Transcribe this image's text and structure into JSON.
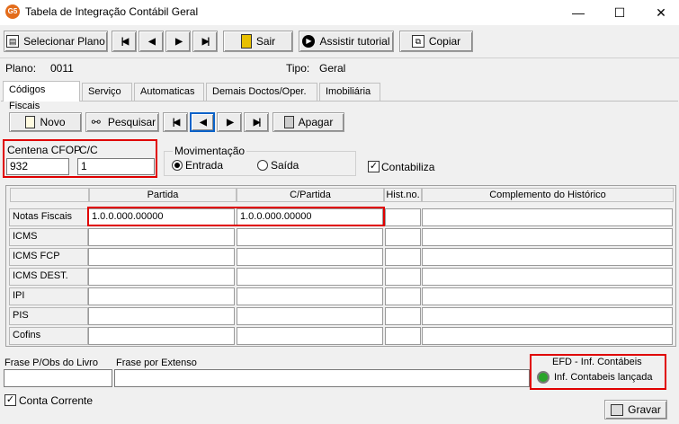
{
  "window": {
    "title": "Tabela de Integração Contábil Geral",
    "app_icon": "G5",
    "minimize": "—",
    "maximize": "☐",
    "close": "✕"
  },
  "toolbar": {
    "select_plan": "Selecionar Plano",
    "exit": "Sair",
    "tutorial": "Assistir tutorial",
    "copy": "Copiar"
  },
  "plan": {
    "plano_label": "Plano:",
    "plano_value": "0011",
    "tipo_label": "Tipo:",
    "tipo_value": "Geral"
  },
  "tabs": [
    {
      "label": "Códigos Fiscais"
    },
    {
      "label": "Serviço"
    },
    {
      "label": "Automaticas"
    },
    {
      "label": "Demais Doctos/Oper."
    },
    {
      "label": "Imobiliária"
    }
  ],
  "actions": {
    "new": "Novo",
    "search": "Pesquisar",
    "delete": "Apagar"
  },
  "fields": {
    "centena_label": "Centena CFOP",
    "centena_value": "932",
    "cc_label": "C/C",
    "cc_value": "1",
    "movimentacao_label": "Movimentação",
    "entrada_label": "Entrada",
    "saida_label": "Saída",
    "contabiliza_label": "Contabiliza"
  },
  "grid": {
    "headers": [
      "Partida",
      "C/Partida",
      "Hist.no.",
      "Complemento do Histórico"
    ],
    "rows": [
      {
        "label": "Notas Fiscais",
        "partida": "1.0.0.000.00000",
        "cpartida": "1.0.0.000.00000",
        "hist": "",
        "comp": ""
      },
      {
        "label": "ICMS",
        "partida": "",
        "cpartida": "",
        "hist": "",
        "comp": ""
      },
      {
        "label": "ICMS FCP",
        "partida": "",
        "cpartida": "",
        "hist": "",
        "comp": ""
      },
      {
        "label": "ICMS DEST.",
        "partida": "",
        "cpartida": "",
        "hist": "",
        "comp": ""
      },
      {
        "label": "IPI",
        "partida": "",
        "cpartida": "",
        "hist": "",
        "comp": ""
      },
      {
        "label": "PIS",
        "partida": "",
        "cpartida": "",
        "hist": "",
        "comp": ""
      },
      {
        "label": "Cofins",
        "partida": "",
        "cpartida": "",
        "hist": "",
        "comp": ""
      }
    ]
  },
  "bottom": {
    "frase_obs_label": "Frase P/Obs do Livro",
    "frase_extenso_label": "Frase por Extenso",
    "efd_title": "EFD - Inf. Contábeis",
    "efd_value": "Inf. Contabeis lançada",
    "conta_corrente_label": "Conta Corrente",
    "save": "Gravar"
  }
}
